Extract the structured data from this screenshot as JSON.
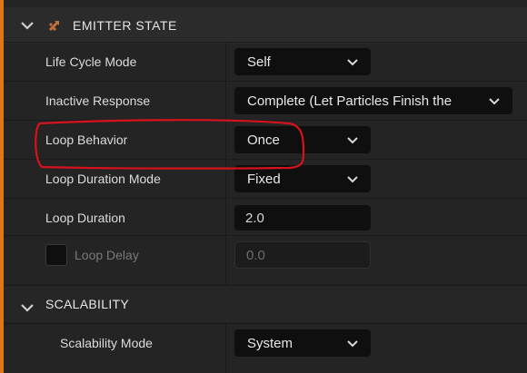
{
  "header": {
    "title": "EMITTER STATE"
  },
  "rows": [
    {
      "label": "Life Cycle Mode",
      "value": "Self"
    },
    {
      "label": "Inactive Response",
      "value": "Complete (Let Particles Finish the"
    },
    {
      "label": "Loop Behavior",
      "value": "Once"
    },
    {
      "label": "Loop Duration Mode",
      "value": "Fixed"
    },
    {
      "label": "Loop Duration",
      "value": "2.0"
    },
    {
      "label": "Loop Delay",
      "value": "0.0"
    }
  ],
  "scalability": {
    "title": "SCALABILITY",
    "mode_label": "Scalability Mode",
    "mode_value": "System"
  },
  "colors": {
    "accent": "#e0761a",
    "annotation": "#d8121c"
  }
}
